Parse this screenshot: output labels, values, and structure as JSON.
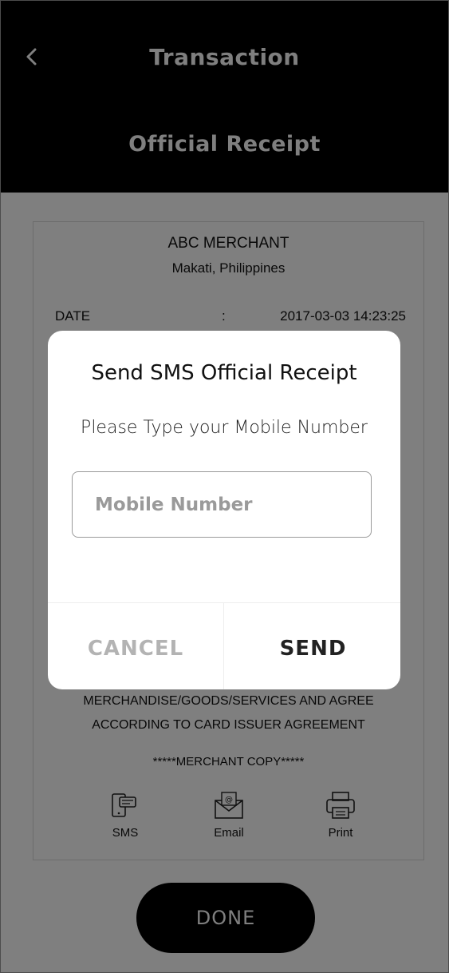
{
  "header": {
    "title": "Transaction",
    "subtitle": "Official Receipt"
  },
  "receipt": {
    "merchant": "ABC MERCHANT",
    "location": "Makati, Philippines",
    "date_label": "DATE",
    "date_colon": ":",
    "date_value": "2017-03-03  14:23:25",
    "notice_line1": "MERCHANDISE/GOODS/SERVICES AND AGREE",
    "notice_line2": "ACCORDING TO CARD ISSUER AGREEMENT",
    "copy_label": "*****MERCHANT COPY*****",
    "share": [
      {
        "label": "SMS",
        "icon": "sms-icon"
      },
      {
        "label": "Email",
        "icon": "email-icon"
      },
      {
        "label": "Print",
        "icon": "print-icon"
      }
    ]
  },
  "done_label": "DONE",
  "dialog": {
    "title": "Send SMS Official Receipt",
    "message": "Please Type your Mobile Number",
    "input_placeholder": "Mobile Number",
    "input_value": "",
    "cancel_label": "CANCEL",
    "send_label": "SEND"
  },
  "colors": {
    "header_bg": "#000000",
    "overlay": "rgba(0,0,0,0.5)",
    "cancel_text": "#b3b3b3",
    "send_text": "#222222"
  }
}
